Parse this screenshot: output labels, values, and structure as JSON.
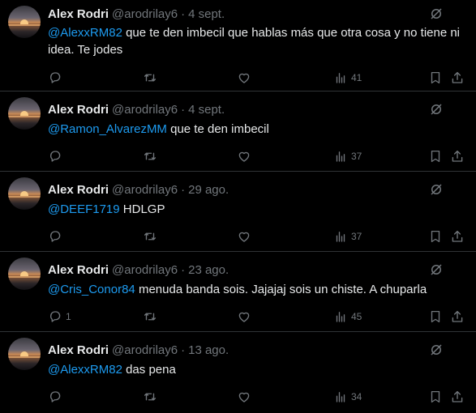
{
  "tweets": [
    {
      "name": "Alex Rodri",
      "handle": "@arodrilay6",
      "sep": "·",
      "date": "4 sept.",
      "mention": "@AlexxRM82",
      "text": " que te den imbecil que hablas más que otra cosa y no tiene ni idea. Te jodes",
      "replies": "",
      "views": "41"
    },
    {
      "name": "Alex Rodri",
      "handle": "@arodrilay6",
      "sep": "·",
      "date": "4 sept.",
      "mention": "@Ramon_AlvarezMM",
      "text": " que te den imbecil",
      "replies": "",
      "views": "37"
    },
    {
      "name": "Alex Rodri",
      "handle": "@arodrilay6",
      "sep": "·",
      "date": "29 ago.",
      "mention": "@DEEF1719",
      "text": " HDLGP",
      "replies": "",
      "views": "37"
    },
    {
      "name": "Alex Rodri",
      "handle": "@arodrilay6",
      "sep": "·",
      "date": "23 ago.",
      "mention": "@Cris_Conor84",
      "text": " menuda banda sois. Jajajaj sois un chiste. A chuparla",
      "replies": "1",
      "views": "45"
    },
    {
      "name": "Alex Rodri",
      "handle": "@arodrilay6",
      "sep": "·",
      "date": "13 ago.",
      "mention": "@AlexxRM82",
      "text": " das pena",
      "replies": "",
      "views": "34"
    }
  ],
  "icons": {
    "grok": "grok-icon",
    "reply": "reply-icon",
    "retweet": "retweet-icon",
    "like": "heart-icon",
    "views": "views-icon",
    "bookmark": "bookmark-icon",
    "share": "share-icon"
  },
  "colors": {
    "background": "#000000",
    "text": "#e7e9ea",
    "muted": "#71767b",
    "link": "#1d9bf0",
    "divider": "#2f3336"
  }
}
